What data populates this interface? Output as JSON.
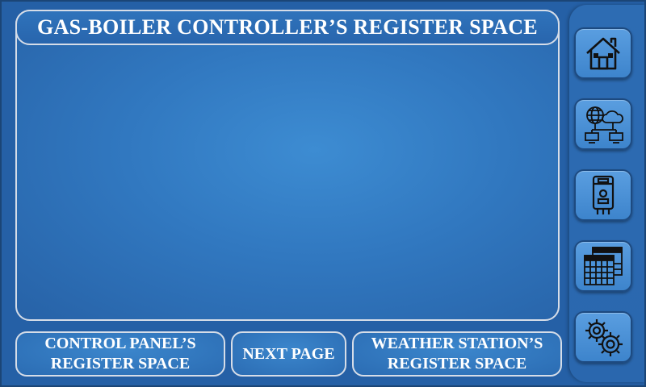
{
  "header": {
    "title": "GAS-BOILER CONTROLLER’S REGISTER SPACE"
  },
  "footer": {
    "control_panel_label": "CONTROL PANEL’S\nREGISTER SPACE",
    "next_page_label": "NEXT PAGE",
    "weather_station_label": "WEATHER STATION’S\nREGISTER SPACE"
  },
  "sidebar": {
    "items": [
      {
        "icon": "home-icon"
      },
      {
        "icon": "network-cloud-icon"
      },
      {
        "icon": "boiler-icon"
      },
      {
        "icon": "calendar-icon"
      },
      {
        "icon": "gears-icon"
      }
    ]
  },
  "colors": {
    "background": "#2560a6",
    "panel_border": "#d6dde8",
    "button": "#3d84cc",
    "text": "#ffffff"
  }
}
